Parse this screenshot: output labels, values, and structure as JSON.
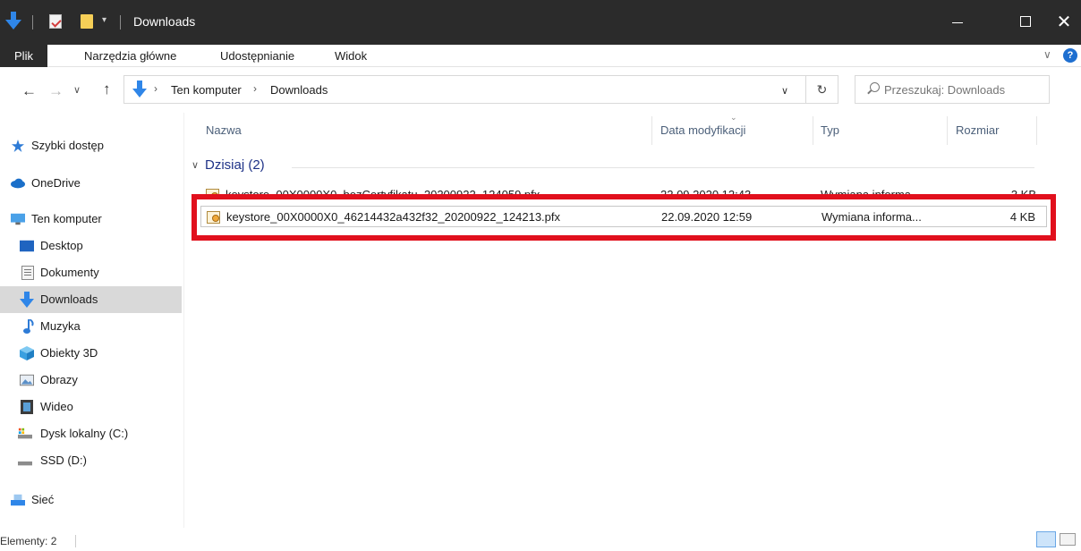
{
  "window": {
    "title": "Downloads",
    "quick_access_menu": "▾"
  },
  "window_controls": {
    "close": "✕"
  },
  "ribbon": {
    "tabs": [
      "Plik",
      "Narzędzia główne",
      "Udostępnianie",
      "Widok"
    ],
    "collapse": "∨",
    "help": "?"
  },
  "navigation": {
    "back": "←",
    "forward": "→",
    "recent": "∨",
    "up": "↑",
    "breadcrumb_separator": "›",
    "breadcrumb": [
      "Ten komputer",
      "Downloads"
    ],
    "dropdown": "∨",
    "refresh": "↻"
  },
  "search": {
    "placeholder": "Przeszukaj: Downloads"
  },
  "sidebar": {
    "items": [
      {
        "label": "Szybki dostęp",
        "icon": "star-icon"
      },
      {
        "label": "OneDrive",
        "icon": "cloud-icon"
      },
      {
        "label": "Ten komputer",
        "icon": "computer-icon"
      },
      {
        "label": "Desktop",
        "icon": "desktop-icon"
      },
      {
        "label": "Dokumenty",
        "icon": "document-icon"
      },
      {
        "label": "Downloads",
        "icon": "download-icon"
      },
      {
        "label": "Muzyka",
        "icon": "music-icon"
      },
      {
        "label": "Obiekty 3D",
        "icon": "cube-icon"
      },
      {
        "label": "Obrazy",
        "icon": "picture-icon"
      },
      {
        "label": "Wideo",
        "icon": "video-icon"
      },
      {
        "label": "Dysk lokalny (C:)",
        "icon": "drive-icon"
      },
      {
        "label": "SSD (D:)",
        "icon": "drive-icon"
      },
      {
        "label": "Sieć",
        "icon": "network-icon"
      }
    ],
    "selected": "Downloads"
  },
  "columns": {
    "name": "Nazwa",
    "date": "Data modyfikacji",
    "type": "Typ",
    "size": "Rozmiar"
  },
  "group": {
    "chevron": "∨",
    "label": "Dzisiaj (2)"
  },
  "files": [
    {
      "name": "keystore_00X0000X0_bezCertyfikatu_20200922_124059.pfx",
      "date": "22.09.2020 12:43",
      "type": "Wymiana informa...",
      "size": "3 KB"
    },
    {
      "name": "keystore_00X0000X0_46214432a432f32_20200922_124213.pfx",
      "date": "22.09.2020 12:59",
      "type": "Wymiana informa...",
      "size": "4 KB"
    }
  ],
  "status": {
    "items_count": "Elementy: 2"
  },
  "colors": {
    "titlebar": "#2b2b2b",
    "highlight": "#e1101d",
    "selection": "#d9d9d9",
    "accent": "#1e6fd0"
  }
}
